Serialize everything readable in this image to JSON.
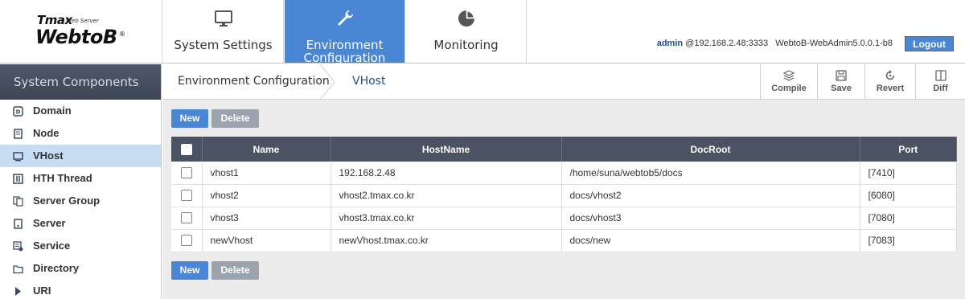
{
  "app": {
    "logo_top": "Tmax",
    "logo_top_sub": "Web Server",
    "logo_main": "WebtoB",
    "logo_reg": "®"
  },
  "nav": {
    "tabs": [
      {
        "label": "System Settings",
        "icon": "monitor-icon",
        "active": false
      },
      {
        "label": "Environment Configuration",
        "icon": "wrench-icon",
        "active": true
      },
      {
        "label": "Monitoring",
        "icon": "pie-chart-icon",
        "active": false
      }
    ]
  },
  "user": {
    "name": "admin",
    "address": "@192.168.2.48:3333",
    "version": "WebtoB-WebAdmin5.0.0.1-b8",
    "logout_label": "Logout"
  },
  "sidebar": {
    "title": "System Components",
    "items": [
      {
        "label": "Domain",
        "icon": "domain-icon",
        "active": false
      },
      {
        "label": "Node",
        "icon": "node-icon",
        "active": false
      },
      {
        "label": "VHost",
        "icon": "vhost-icon",
        "active": true
      },
      {
        "label": "HTH Thread",
        "icon": "thread-icon",
        "active": false
      },
      {
        "label": "Server Group",
        "icon": "server-group-icon",
        "active": false
      },
      {
        "label": "Server",
        "icon": "server-icon",
        "active": false
      },
      {
        "label": "Service",
        "icon": "service-icon",
        "active": false
      },
      {
        "label": "Directory",
        "icon": "folder-icon",
        "active": false
      },
      {
        "label": "URI",
        "icon": "uri-icon",
        "active": false
      }
    ]
  },
  "breadcrumb": {
    "parent": "Environment Configuration",
    "current": "VHost"
  },
  "toolbar": {
    "compile": "Compile",
    "save": "Save",
    "revert": "Revert",
    "diff": "Diff"
  },
  "actions": {
    "new_label": "New",
    "delete_label": "Delete"
  },
  "table": {
    "columns": [
      "Name",
      "HostName",
      "DocRoot",
      "Port"
    ],
    "rows": [
      {
        "name": "vhost1",
        "hostname": "192.168.2.48",
        "docroot": "/home/suna/webtob5/docs",
        "port": "[7410]"
      },
      {
        "name": "vhost2",
        "hostname": "vhost2.tmax.co.kr",
        "docroot": "docs/vhost2",
        "port": "[6080]"
      },
      {
        "name": "vhost3",
        "hostname": "vhost3.tmax.co.kr",
        "docroot": "docs/vhost3",
        "port": "[7080]"
      },
      {
        "name": "newVhost",
        "hostname": "newVhost.tmax.co.kr",
        "docroot": "docs/new",
        "port": "[7083]"
      }
    ]
  },
  "colors": {
    "accent": "#4a86d4",
    "header_dark": "#4a5263",
    "sidebar_active": "#c6ddf4"
  }
}
